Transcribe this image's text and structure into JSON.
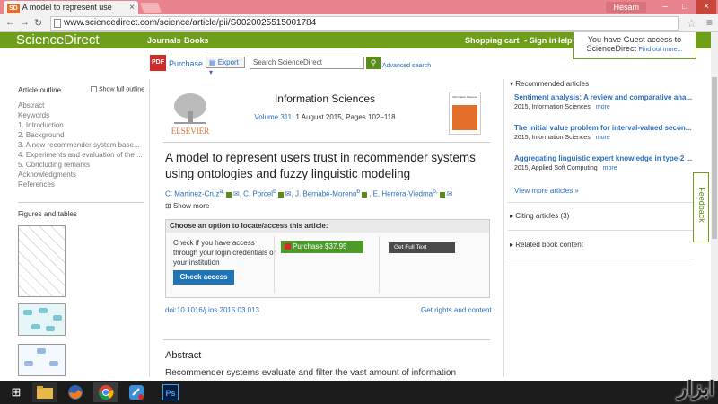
{
  "browser": {
    "tab_title": "A model to represent use",
    "tab_favicon": "SD",
    "user": "Hesam",
    "url": "www.sciencedirect.com/science/article/pii/S0020025515001784"
  },
  "header": {
    "logo": "ScienceDirect",
    "nav": [
      "Journals",
      "Books"
    ],
    "shopping_cart": "Shopping cart",
    "sign_in": "Sign in",
    "help": "Help",
    "guest_line1": "You have Guest access to",
    "guest_line2": "ScienceDirect",
    "find_out": "Find out more..."
  },
  "toolbar": {
    "pdf_label": "PDF",
    "purchase": "Purchase",
    "export": "Export",
    "search_placeholder": "Search ScienceDirect",
    "advanced_search": "Advanced search"
  },
  "outline": {
    "title": "Article outline",
    "show_full": "Show full outline",
    "items": [
      "Abstract",
      "Keywords",
      "1. Introduction",
      "2. Background",
      "3. A new recommender system base...",
      "4. Experiments and evaluation of the ...",
      "5. Concluding remarks",
      "Acknowledgments",
      "References"
    ],
    "figures_title": "Figures and tables"
  },
  "journal": {
    "publisher": "ELSEVIER",
    "name": "Information Sciences",
    "volume_link": "Volume 311",
    "volume_rest": ", 1 August 2015, Pages 102–118"
  },
  "article": {
    "title": "A model to represent users trust in recommender systems using ontologies and fuzzy linguistic modeling",
    "authors": [
      "C. Martinez-Cruz",
      "C. Porcel",
      "J. Bernabé-Moreno",
      "E. Herrera-Viedma"
    ],
    "show_more": "Show more",
    "locate_head": "Choose an option to locate/access this article:",
    "locate_text": "Check if you have access through your login credentials or your institution",
    "check_access": "Check access",
    "purchase_btn": "Purchase $37.95",
    "full_text": "Get Full Text Elsewhere",
    "doi": "doi:10.1016/j.ins.2015.03.013",
    "rights": "Get rights and content",
    "abstract_head": "Abstract",
    "abstract_text": "Recommender systems evaluate and filter the vast amount of information available on"
  },
  "right": {
    "recommended_title": "Recommended articles",
    "items": [
      {
        "title": "Sentiment analysis: A review and comparative ana...",
        "meta": "2015, Information Sciences",
        "more": "more"
      },
      {
        "title": "The initial value problem for interval-valued secon...",
        "meta": "2015, Information Sciences",
        "more": "more"
      },
      {
        "title": "Aggregating linguistic expert knowledge in type-2 ...",
        "meta": "2015, Applied Soft Computing",
        "more": "more"
      }
    ],
    "view_more": "View more articles »",
    "citing": "Citing articles (3)",
    "related": "Related book content",
    "feedback": "Feedback"
  },
  "taskbar": {
    "ps_label": "Ps"
  },
  "colors": {
    "brand_green": "#6f9e1a",
    "link_blue": "#2a6ebb",
    "elsevier_orange": "#e46f2a"
  }
}
